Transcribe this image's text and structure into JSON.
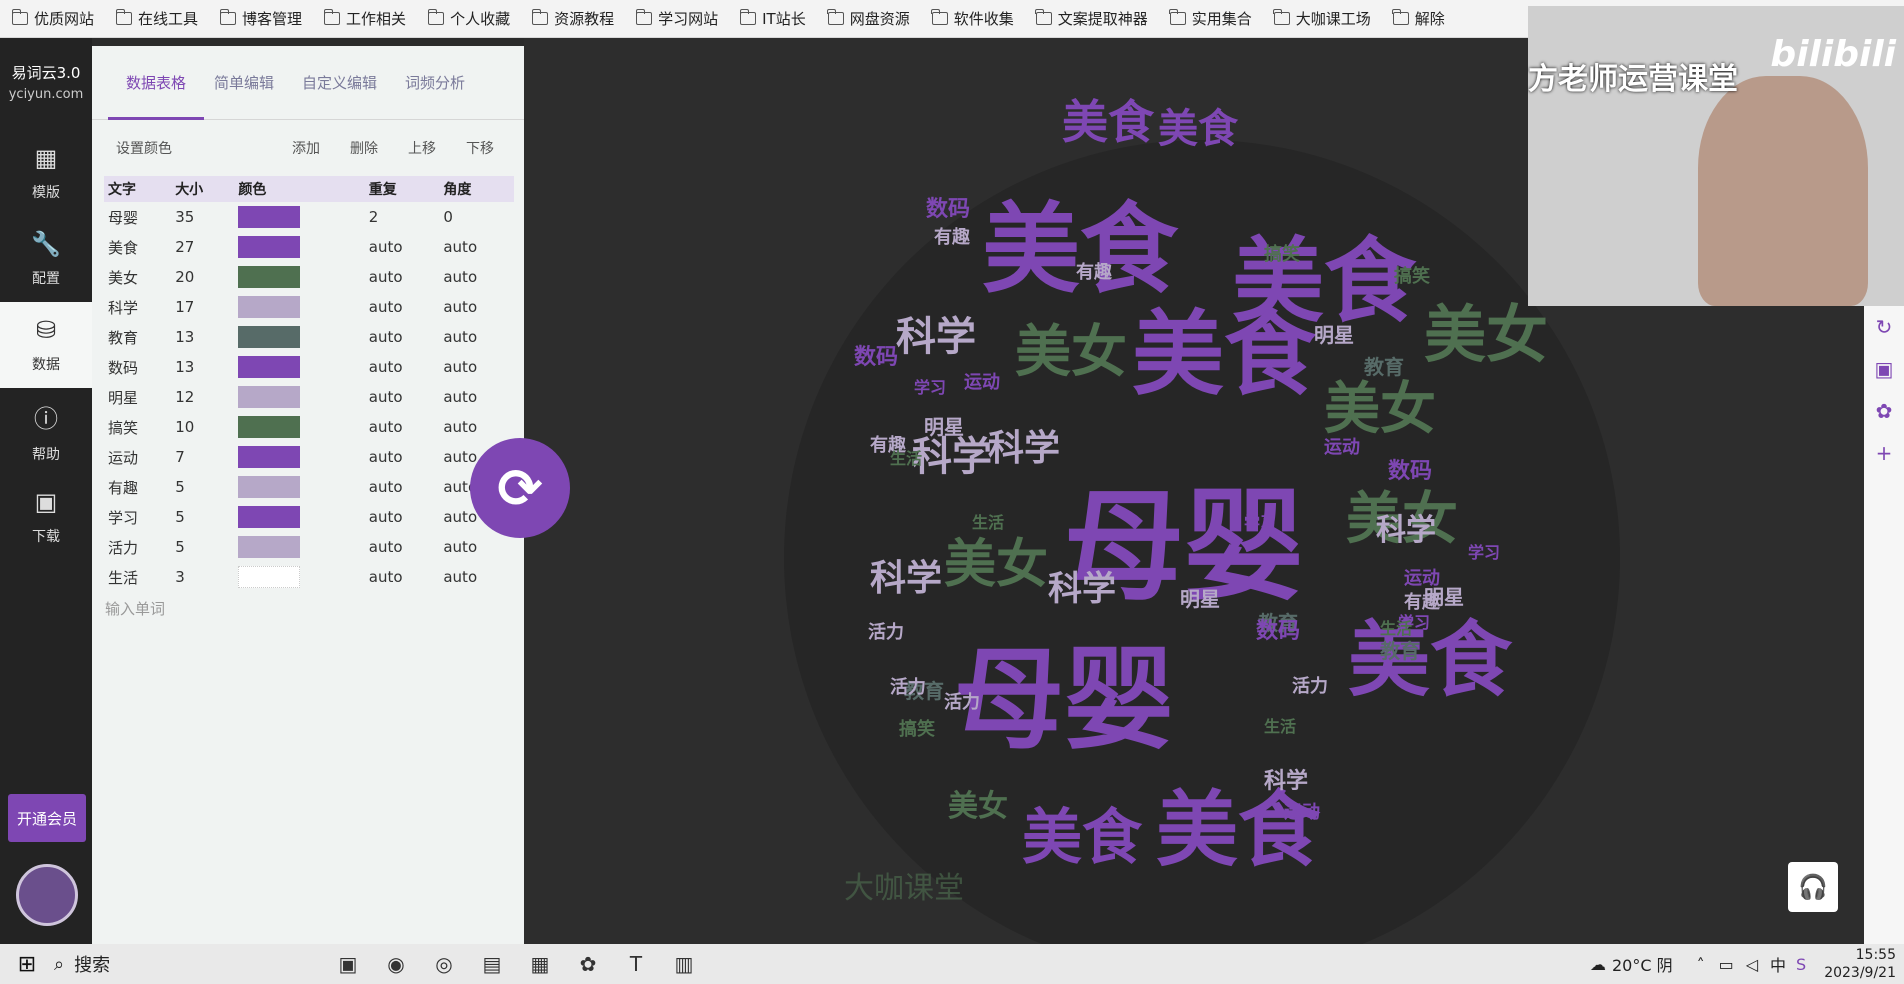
{
  "bookmarks": [
    "优质网站",
    "在线工具",
    "博客管理",
    "工作相关",
    "个人收藏",
    "资源教程",
    "学习网站",
    "IT站长",
    "网盘资源",
    "软件收集",
    "文案提取神器",
    "实用集合",
    "大咖课工场",
    "解除"
  ],
  "app": {
    "name": "易词云3.0",
    "url": "yciyun.com"
  },
  "sidebar": {
    "items": [
      {
        "label": "模版",
        "icon": "template-icon"
      },
      {
        "label": "配置",
        "icon": "wrench-icon"
      },
      {
        "label": "数据",
        "icon": "data-icon"
      },
      {
        "label": "帮助",
        "icon": "help-icon"
      },
      {
        "label": "下载",
        "icon": "save-icon"
      }
    ],
    "vip": "开通会员"
  },
  "tabs": [
    "数据表格",
    "简单编辑",
    "自定义编辑",
    "词频分析"
  ],
  "toolbar": {
    "color": "设置颜色",
    "add": "添加",
    "delete": "删除",
    "up": "上移",
    "down": "下移"
  },
  "table": {
    "headers": [
      "文字",
      "大小",
      "颜色",
      "重复",
      "角度"
    ],
    "rows": [
      {
        "word": "母婴",
        "size": "35",
        "color": "#7e47b3",
        "repeat": "2",
        "angle": "0"
      },
      {
        "word": "美食",
        "size": "27",
        "color": "#7e47b3",
        "repeat": "auto",
        "angle": "auto"
      },
      {
        "word": "美女",
        "size": "20",
        "color": "#4f7050",
        "repeat": "auto",
        "angle": "auto"
      },
      {
        "word": "科学",
        "size": "17",
        "color": "#b6a8c8",
        "repeat": "auto",
        "angle": "auto"
      },
      {
        "word": "教育",
        "size": "13",
        "color": "#576b68",
        "repeat": "auto",
        "angle": "auto"
      },
      {
        "word": "数码",
        "size": "13",
        "color": "#7e47b3",
        "repeat": "auto",
        "angle": "auto"
      },
      {
        "word": "明星",
        "size": "12",
        "color": "#b6a8c8",
        "repeat": "auto",
        "angle": "auto"
      },
      {
        "word": "搞笑",
        "size": "10",
        "color": "#4f7050",
        "repeat": "auto",
        "angle": "auto"
      },
      {
        "word": "运动",
        "size": "7",
        "color": "#7e47b3",
        "repeat": "auto",
        "angle": "auto"
      },
      {
        "word": "有趣",
        "size": "5",
        "color": "#b6a8c8",
        "repeat": "auto",
        "angle": "auto"
      },
      {
        "word": "学习",
        "size": "5",
        "color": "#7e47b3",
        "repeat": "auto",
        "angle": "auto"
      },
      {
        "word": "活力",
        "size": "5",
        "color": "#b6a8c8",
        "repeat": "auto",
        "angle": "auto"
      },
      {
        "word": "生活",
        "size": "3",
        "color": "#ffffff",
        "repeat": "auto",
        "angle": "auto"
      }
    ],
    "input_placeholder": "输入单词"
  },
  "cloud_words": [
    {
      "t": "母婴",
      "fill": "#7e47b3",
      "s": 120
    },
    {
      "t": "母婴",
      "fill": "#7e47b3",
      "s": 110
    },
    {
      "t": "美食",
      "fill": "#7e47b3",
      "s": 98
    },
    {
      "t": "美食",
      "fill": "#7e47b3",
      "s": 92
    },
    {
      "t": "美食",
      "fill": "#7e47b3",
      "s": 92
    },
    {
      "t": "美食",
      "fill": "#7e47b3",
      "s": 82
    },
    {
      "t": "美食",
      "fill": "#7e47b3",
      "s": 82
    },
    {
      "t": "美食",
      "fill": "#7e47b3",
      "s": 60
    },
    {
      "t": "美食",
      "fill": "#7e47b3",
      "s": 46
    },
    {
      "t": "美食",
      "fill": "#7e47b3",
      "s": 40
    },
    {
      "t": "美女",
      "fill": "#4f7050",
      "s": 62
    },
    {
      "t": "美女",
      "fill": "#4f7050",
      "s": 56
    },
    {
      "t": "美女",
      "fill": "#4f7050",
      "s": 56
    },
    {
      "t": "美女",
      "fill": "#4f7050",
      "s": 56
    },
    {
      "t": "美女",
      "fill": "#4f7050",
      "s": 52
    },
    {
      "t": "美女",
      "fill": "#4f7050",
      "s": 30
    },
    {
      "t": "科学",
      "fill": "#b6a8c8",
      "s": 40
    },
    {
      "t": "科学",
      "fill": "#b6a8c8",
      "s": 40
    },
    {
      "t": "科学",
      "fill": "#b6a8c8",
      "s": 36
    },
    {
      "t": "科学",
      "fill": "#b6a8c8",
      "s": 36
    },
    {
      "t": "科学",
      "fill": "#b6a8c8",
      "s": 34
    },
    {
      "t": "科学",
      "fill": "#b6a8c8",
      "s": 30
    },
    {
      "t": "科学",
      "fill": "#b6a8c8",
      "s": 22
    },
    {
      "t": "教育",
      "fill": "#576b68",
      "s": 20
    },
    {
      "t": "教育",
      "fill": "#576b68",
      "s": 20
    },
    {
      "t": "教育",
      "fill": "#576b68",
      "s": 20
    },
    {
      "t": "教育",
      "fill": "#576b68",
      "s": 20
    },
    {
      "t": "数码",
      "fill": "#7e47b3",
      "s": 22
    },
    {
      "t": "数码",
      "fill": "#7e47b3",
      "s": 22
    },
    {
      "t": "数码",
      "fill": "#7e47b3",
      "s": 22
    },
    {
      "t": "数码",
      "fill": "#7e47b3",
      "s": 22
    },
    {
      "t": "明星",
      "fill": "#b6a8c8",
      "s": 20
    },
    {
      "t": "明星",
      "fill": "#b6a8c8",
      "s": 20
    },
    {
      "t": "明星",
      "fill": "#b6a8c8",
      "s": 20
    },
    {
      "t": "明星",
      "fill": "#b6a8c8",
      "s": 20
    },
    {
      "t": "搞笑",
      "fill": "#4f7050",
      "s": 18
    },
    {
      "t": "搞笑",
      "fill": "#4f7050",
      "s": 18
    },
    {
      "t": "搞笑",
      "fill": "#4f7050",
      "s": 18
    },
    {
      "t": "运动",
      "fill": "#7e47b3",
      "s": 18
    },
    {
      "t": "运动",
      "fill": "#7e47b3",
      "s": 18
    },
    {
      "t": "运动",
      "fill": "#7e47b3",
      "s": 18
    },
    {
      "t": "运动",
      "fill": "#7e47b3",
      "s": 18
    },
    {
      "t": "有趣",
      "fill": "#b6a8c8",
      "s": 18
    },
    {
      "t": "有趣",
      "fill": "#b6a8c8",
      "s": 18
    },
    {
      "t": "有趣",
      "fill": "#b6a8c8",
      "s": 18
    },
    {
      "t": "有趣",
      "fill": "#b6a8c8",
      "s": 18
    },
    {
      "t": "学习",
      "fill": "#7e47b3",
      "s": 16
    },
    {
      "t": "学习",
      "fill": "#7e47b3",
      "s": 16
    },
    {
      "t": "学习",
      "fill": "#7e47b3",
      "s": 16
    },
    {
      "t": "学习",
      "fill": "#7e47b3",
      "s": 16
    },
    {
      "t": "活力",
      "fill": "#b6a8c8",
      "s": 18
    },
    {
      "t": "活力",
      "fill": "#b6a8c8",
      "s": 18
    },
    {
      "t": "活力",
      "fill": "#b6a8c8",
      "s": 18
    },
    {
      "t": "活力",
      "fill": "#b6a8c8",
      "s": 18
    },
    {
      "t": "生活",
      "fill": "#4f7050",
      "s": 16
    },
    {
      "t": "生活",
      "fill": "#4f7050",
      "s": 16
    },
    {
      "t": "生活",
      "fill": "#4f7050",
      "s": 16
    },
    {
      "t": "生活",
      "fill": "#4f7050",
      "s": 16
    }
  ],
  "watermark": "大咖课堂",
  "video_overlay": {
    "title": "方老师运营课堂",
    "logo": "bilibili"
  },
  "taskbar": {
    "search": "搜索",
    "weather": "20°C 阴",
    "ime": "中",
    "time": "15:55",
    "date": "2023/9/21"
  }
}
